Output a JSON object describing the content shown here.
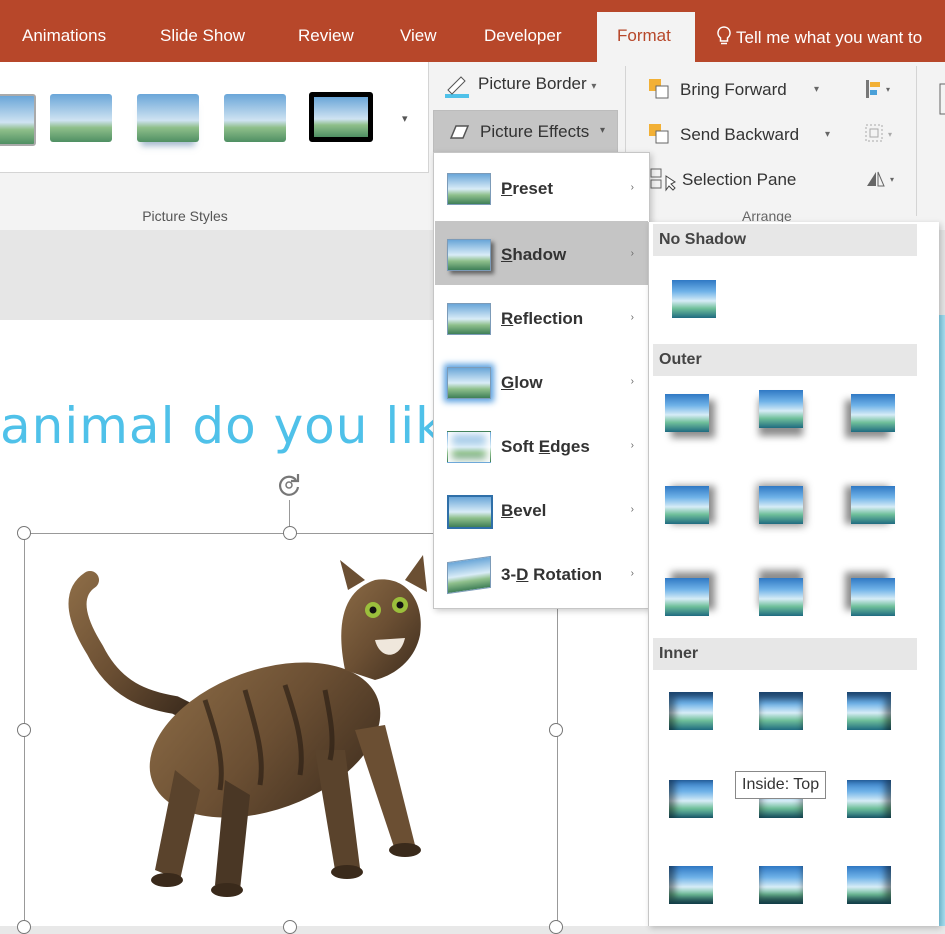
{
  "tabs": {
    "animations": "Animations",
    "slide_show": "Slide Show",
    "review": "Review",
    "view": "View",
    "developer": "Developer",
    "format": "Format",
    "tell_me": "Tell me what you want to"
  },
  "ribbon": {
    "picture_styles_label": "Picture Styles",
    "picture_border": "Picture Border",
    "picture_effects": "Picture Effects",
    "bring_forward": "Bring Forward",
    "send_backward": "Send Backward",
    "selection_pane": "Selection Pane",
    "arrange_label": "Arrange",
    "dropdown_glyph": "▾"
  },
  "slide": {
    "title_fragment": "animal do you like"
  },
  "effects_menu": {
    "items": [
      {
        "label": "Preset",
        "accel": "P"
      },
      {
        "label": "Shadow",
        "accel": "S"
      },
      {
        "label": "Reflection",
        "accel": "R"
      },
      {
        "label": "Glow",
        "accel": "G"
      },
      {
        "label": "Soft Edges",
        "accel": "E"
      },
      {
        "label": "Bevel",
        "accel": "B"
      },
      {
        "label": "3-D Rotation",
        "accel": "D"
      }
    ],
    "submenu_arrow": "›"
  },
  "shadow_menu": {
    "no_shadow": "No Shadow",
    "outer": "Outer",
    "inner": "Inner"
  },
  "tooltip": "Inside: Top",
  "colors": {
    "tab_bar": "#b7472a",
    "title_text": "#4fc1e9",
    "menu_active": "#c5c5c5"
  }
}
